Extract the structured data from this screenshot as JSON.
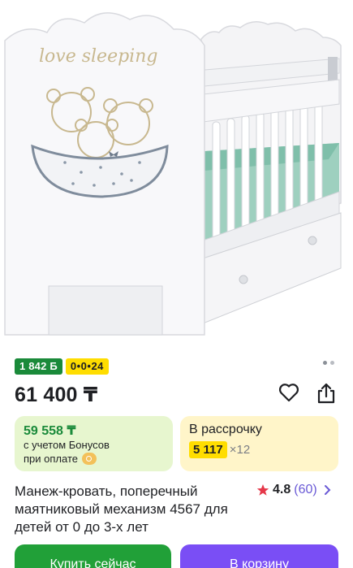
{
  "product_image": {
    "alt": "crib",
    "decal_text": "love sleeping"
  },
  "gallery": {
    "dots": 2,
    "active": 1
  },
  "badges": {
    "bonus": "1 842 Б",
    "installment_plan": "0•0•24"
  },
  "price": "61 400 ₸",
  "icons": {
    "favorite": "heart-icon",
    "share": "share-icon"
  },
  "bonus_card": {
    "price": "59 558 ₸",
    "line1": "с учетом Бонусов",
    "line2": "при оплате",
    "icon": "bonus-coin-icon"
  },
  "installment_card": {
    "title": "В рассрочку",
    "amount": "5 117",
    "multiplier": "×12"
  },
  "product_title": "Манеж-кровать, поперечный маятниковый механизм 4567 для детей от 0 до 3-х лет",
  "rating": {
    "value": "4.8",
    "count": "(60)"
  },
  "actions": {
    "buy_now": "Купить сейчас",
    "add_to_cart": "В корзину"
  },
  "colors": {
    "green_badge": "#1a8a3a",
    "yellow_badge": "#ffdd00",
    "buy_button": "#21a038",
    "cart_button": "#7a4ef5",
    "rating_count": "#6a5ad6",
    "star": "#e5384a"
  }
}
